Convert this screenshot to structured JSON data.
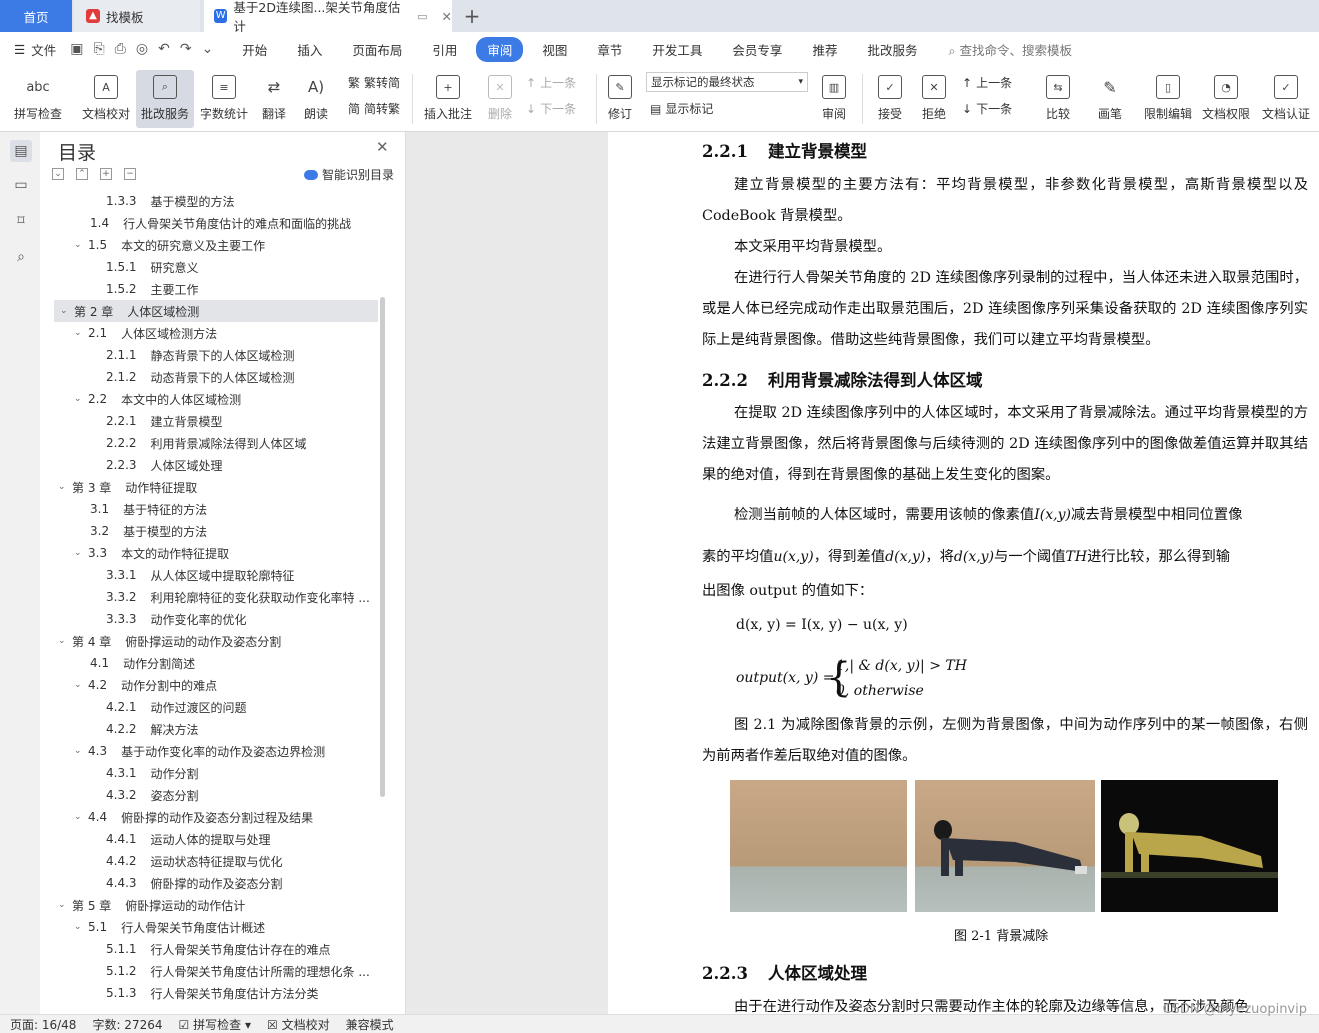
{
  "tabs": {
    "home": "首页",
    "template": "找模板",
    "document": "基于2D连续图...架关节角度估计"
  },
  "menu": {
    "file": "文件",
    "tabs": [
      "开始",
      "插入",
      "页面布局",
      "引用",
      "审阅",
      "视图",
      "章节",
      "开发工具",
      "会员专享",
      "推荐",
      "批改服务"
    ],
    "active_tab": "审阅",
    "search": "查找命令、搜索模板"
  },
  "ribbon": {
    "spell": "拼写检查",
    "proof": "文档校对",
    "review_service": "批改服务",
    "word_count": "字数统计",
    "translate": "翻译",
    "read": "朗读",
    "trad": "繁转简",
    "simp": "简转繁",
    "insert_comment": "插入批注",
    "delete": "删除",
    "prev_comment": "上一条",
    "next_comment": "下一条",
    "revise": "修订",
    "markup_select": "显示标记的最终状态",
    "show_markup": "显示标记",
    "review": "审阅",
    "accept": "接受",
    "reject": "拒绝",
    "prev_change": "上一条",
    "next_change": "下一条",
    "compare": "比较",
    "pen": "画笔",
    "restrict": "限制编辑",
    "doc_rights": "文档权限",
    "doc_cert": "文档认证"
  },
  "toc": {
    "title": "目录",
    "smart": "智能识别目录",
    "items": [
      {
        "num": "1.3.3",
        "text": "基于模型的方法",
        "level": 3,
        "caret": ""
      },
      {
        "num": "1.4",
        "text": "行人骨架关节角度估计的难点和面临的挑战",
        "level": 2,
        "caret": ""
      },
      {
        "num": "1.5",
        "text": "本文的研究意义及主要工作",
        "level": 2,
        "caret": "v"
      },
      {
        "num": "1.5.1",
        "text": "研究意义",
        "level": 3,
        "caret": ""
      },
      {
        "num": "1.5.2",
        "text": "主要工作",
        "level": 3,
        "caret": ""
      },
      {
        "num": "第 2 章",
        "text": "人体区域检测",
        "level": 1,
        "caret": "v",
        "hl": true
      },
      {
        "num": "2.1",
        "text": "人体区域检测方法",
        "level": 2,
        "caret": "v"
      },
      {
        "num": "2.1.1",
        "text": "静态背景下的人体区域检测",
        "level": 3,
        "caret": ""
      },
      {
        "num": "2.1.2",
        "text": "动态背景下的人体区域检测",
        "level": 3,
        "caret": ""
      },
      {
        "num": "2.2",
        "text": "本文中的人体区域检测",
        "level": 2,
        "caret": "v"
      },
      {
        "num": "2.2.1",
        "text": "建立背景模型",
        "level": 3,
        "caret": ""
      },
      {
        "num": "2.2.2",
        "text": "利用背景减除法得到人体区域",
        "level": 3,
        "caret": ""
      },
      {
        "num": "2.2.3",
        "text": "人体区域处理",
        "level": 3,
        "caret": ""
      },
      {
        "num": "第 3 章",
        "text": "动作特征提取",
        "level": 1,
        "caret": "v"
      },
      {
        "num": "3.1",
        "text": "基于特征的方法",
        "level": 2,
        "caret": ""
      },
      {
        "num": "3.2",
        "text": "基于模型的方法",
        "level": 2,
        "caret": ""
      },
      {
        "num": "3.3",
        "text": "本文的动作特征提取",
        "level": 2,
        "caret": "v"
      },
      {
        "num": "3.3.1",
        "text": "从人体区域中提取轮廓特征",
        "level": 3,
        "caret": ""
      },
      {
        "num": "3.3.2",
        "text": "利用轮廓特征的变化获取动作变化率特 ...",
        "level": 3,
        "caret": ""
      },
      {
        "num": "3.3.3",
        "text": "动作变化率的优化",
        "level": 3,
        "caret": ""
      },
      {
        "num": "第 4 章",
        "text": "俯卧撑运动的动作及姿态分割",
        "level": 1,
        "caret": "v"
      },
      {
        "num": "4.1",
        "text": "动作分割简述",
        "level": 2,
        "caret": ""
      },
      {
        "num": "4.2",
        "text": "动作分割中的难点",
        "level": 2,
        "caret": "v"
      },
      {
        "num": "4.2.1",
        "text": "动作过渡区的问题",
        "level": 3,
        "caret": ""
      },
      {
        "num": "4.2.2",
        "text": "解决方法",
        "level": 3,
        "caret": ""
      },
      {
        "num": "4.3",
        "text": "基于动作变化率的动作及姿态边界检测",
        "level": 2,
        "caret": "v"
      },
      {
        "num": "4.3.1",
        "text": "动作分割",
        "level": 3,
        "caret": ""
      },
      {
        "num": "4.3.2",
        "text": "姿态分割",
        "level": 3,
        "caret": ""
      },
      {
        "num": "4.4",
        "text": "俯卧撑的动作及姿态分割过程及结果",
        "level": 2,
        "caret": "v"
      },
      {
        "num": "4.4.1",
        "text": "运动人体的提取与处理",
        "level": 3,
        "caret": ""
      },
      {
        "num": "4.4.2",
        "text": "运动状态特征提取与优化",
        "level": 3,
        "caret": ""
      },
      {
        "num": "4.4.3",
        "text": "俯卧撑的动作及姿态分割",
        "level": 3,
        "caret": ""
      },
      {
        "num": "第 5 章",
        "text": "俯卧撑运动的动作估计",
        "level": 1,
        "caret": "v"
      },
      {
        "num": "5.1",
        "text": "行人骨架关节角度估计概述",
        "level": 2,
        "caret": "v"
      },
      {
        "num": "5.1.1",
        "text": "行人骨架关节角度估计存在的难点",
        "level": 3,
        "caret": ""
      },
      {
        "num": "5.1.2",
        "text": "行人骨架关节角度估计所需的理想化条 ...",
        "level": 3,
        "caret": ""
      },
      {
        "num": "5.1.3",
        "text": "行人骨架关节角度估计方法分类",
        "level": 3,
        "caret": ""
      }
    ]
  },
  "doc": {
    "h221_num": "2.2.1",
    "h221": "建立背景模型",
    "p1": "建立背景模型的主要方法有：平均背景模型，非参数化背景模型，高斯背景模型以及 CodeBook 背景模型。",
    "p2": "本文采用平均背景模型。",
    "p3": "在进行行人骨架关节角度的 2D 连续图像序列录制的过程中，当人体还未进入取景范围时，或是人体已经完成动作走出取景范围后，2D 连续图像序列采集设备获取的 2D 连续图像序列实际上是纯背景图像。借助这些纯背景图像，我们可以建立平均背景模型。",
    "h222_num": "2.2.2",
    "h222": "利用背景减除法得到人体区域",
    "p4": "在提取 2D 连续图像序列中的人体区域时，本文采用了背景减除法。通过平均背景模型的方法建立背景图像，然后将背景图像与后续待测的 2D 连续图像序列中的图像做差值运算并取其结果的绝对值，得到在背景图像的基础上发生变化的图案。",
    "p5a": "检测当前帧的人体区域时，需要用该帧的像素值",
    "p5b": "减去背景模型中相同位置像",
    "p5c": "素的平均值",
    "p5d": "，得到差值",
    "p5e": "，将",
    "p5f": "与一个阈值",
    "p5g": "进行比较，那么得到输",
    "p5h": "出图像 output 的值如下：",
    "m_I": "I(x,y)",
    "m_u": "u(x,y)",
    "m_d": "d(x,y)",
    "m_TH": "TH",
    "eq1": "d(x, y) = I(x, y) − u(x, y)",
    "eq2_lhs": "output(x, y) =",
    "eq2_c1": "1,| & d(x, y)| > TH",
    "eq2_c2": "0, otherwise",
    "p6": "图 2.1 为减除图像背景的示例，左侧为背景图像，中间为动作序列中的某一帧图像，右侧为前两者作差后取绝对值的图像。",
    "caption": "图 2-1  背景减除",
    "h223_num": "2.2.3",
    "h223": "人体区域处理",
    "p7": "由于在进行动作及姿态分割时只需要动作主体的轮廓及边缘等信息，而不涉及颜色"
  },
  "status": {
    "page": "页面: 16/48",
    "words": "字数: 27264",
    "spell": "拼写检查",
    "proof": "文档校对",
    "compat": "兼容模式"
  },
  "watermark": "CSDN @biyezuopinvip"
}
